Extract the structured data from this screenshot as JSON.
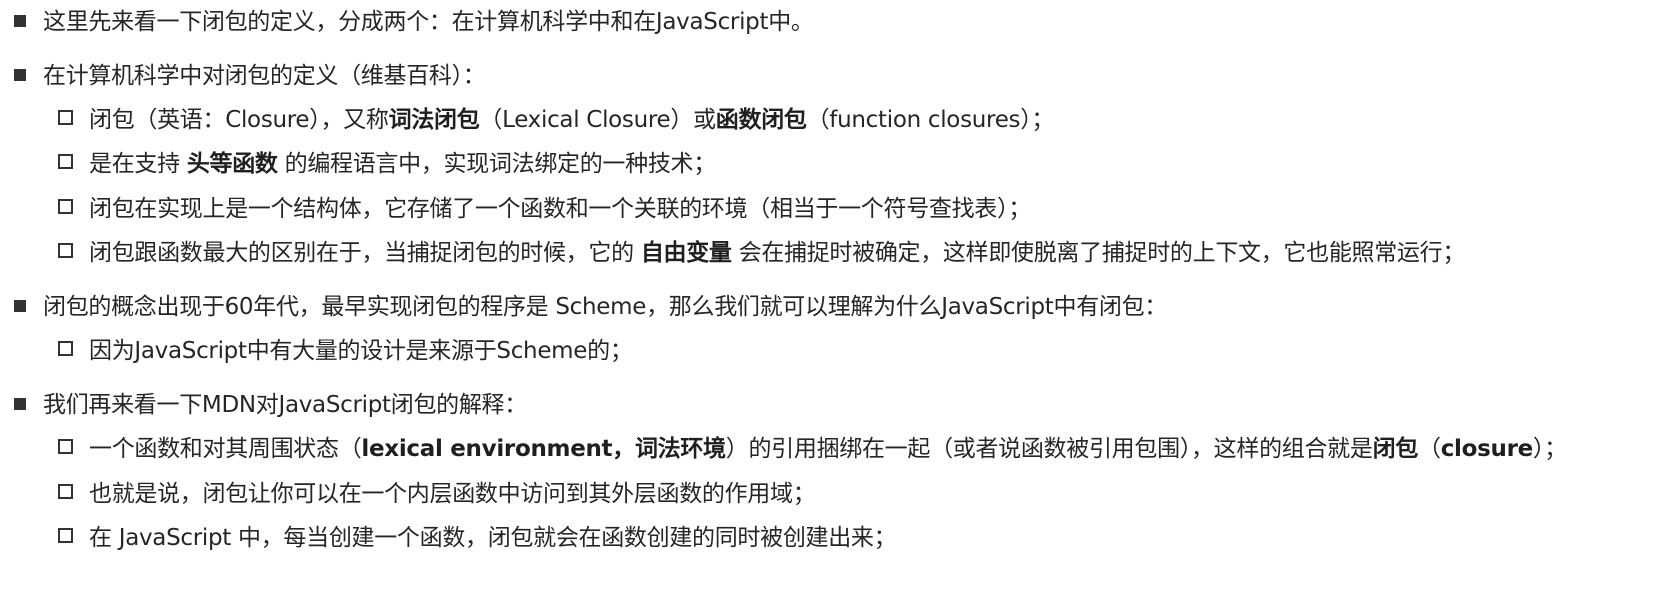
{
  "lines": [
    {
      "level": 1,
      "segments": [
        {
          "text": "这里先来看一下闭包的定义，分成两个：在计算机科学中和在JavaScript中。",
          "bold": false
        }
      ]
    },
    {
      "level": 1,
      "segments": [
        {
          "text": "在计算机科学中对闭包的定义（维基百科）：",
          "bold": false
        }
      ]
    },
    {
      "level": 2,
      "segments": [
        {
          "text": "闭包（英语：Closure），又称",
          "bold": false
        },
        {
          "text": "词法闭包",
          "bold": true
        },
        {
          "text": "（Lexical Closure）或",
          "bold": false
        },
        {
          "text": "函数闭包",
          "bold": true
        },
        {
          "text": "（function closures）；",
          "bold": false
        }
      ]
    },
    {
      "level": 2,
      "segments": [
        {
          "text": "是在支持 ",
          "bold": false
        },
        {
          "text": "头等函数",
          "bold": true
        },
        {
          "text": " 的编程语言中，实现词法绑定的一种技术；",
          "bold": false
        }
      ]
    },
    {
      "level": 2,
      "segments": [
        {
          "text": "闭包在实现上是一个结构体，它存储了一个函数和一个关联的环境（相当于一个符号查找表）；",
          "bold": false
        }
      ]
    },
    {
      "level": 2,
      "segments": [
        {
          "text": "闭包跟函数最大的区别在于，当捕捉闭包的时候，它的 ",
          "bold": false
        },
        {
          "text": "自由变量",
          "bold": true
        },
        {
          "text": " 会在捕捉时被确定，这样即使脱离了捕捉时的上下文，它也能照常运行；",
          "bold": false
        }
      ]
    },
    {
      "level": 1,
      "segments": [
        {
          "text": "闭包的概念出现于60年代，最早实现闭包的程序是 Scheme，那么我们就可以理解为什么JavaScript中有闭包：",
          "bold": false
        }
      ]
    },
    {
      "level": 2,
      "segments": [
        {
          "text": "因为JavaScript中有大量的设计是来源于Scheme的；",
          "bold": false
        }
      ]
    },
    {
      "level": 1,
      "segments": [
        {
          "text": "我们再来看一下MDN对JavaScript闭包的解释：",
          "bold": false
        }
      ]
    },
    {
      "level": 2,
      "segments": [
        {
          "text": "一个函数和对其周围状态（",
          "bold": false
        },
        {
          "text": "lexical environment，词法环境",
          "bold": true
        },
        {
          "text": "）的引用捆绑在一起（或者说函数被引用包围），这样的组合就是",
          "bold": false
        },
        {
          "text": "闭包",
          "bold": true
        },
        {
          "text": "（",
          "bold": false
        },
        {
          "text": "closure",
          "bold": true
        },
        {
          "text": "）；",
          "bold": false
        }
      ]
    },
    {
      "level": 2,
      "segments": [
        {
          "text": "也就是说，闭包让你可以在一个内层函数中访问到其外层函数的作用域；",
          "bold": false
        }
      ]
    },
    {
      "level": 2,
      "segments": [
        {
          "text": "在 JavaScript 中，每当创建一个函数，闭包就会在函数创建的同时被创建出来；",
          "bold": false
        }
      ]
    }
  ]
}
